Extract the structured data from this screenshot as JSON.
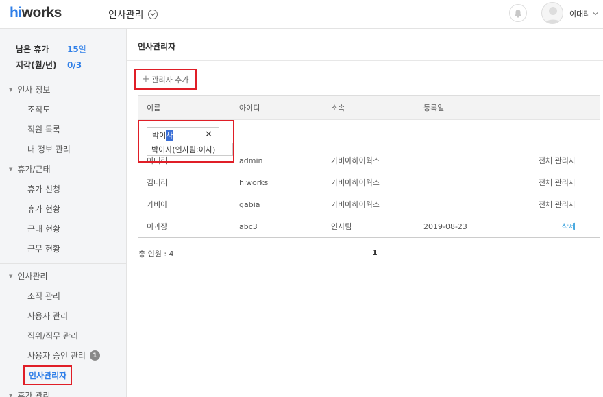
{
  "header": {
    "logo_hi": "hi",
    "logo_rest": "works",
    "app_title": "인사관리",
    "user_name": "이대리"
  },
  "sidebar": {
    "summary": [
      {
        "label": "남은 휴가",
        "value": "15",
        "unit": "일"
      },
      {
        "label": "지각(월/년)",
        "value": "0/3",
        "unit": ""
      }
    ],
    "groups": [
      {
        "title": "인사 정보",
        "items": [
          "조직도",
          "직원 목록",
          "내 정보 관리"
        ]
      },
      {
        "title": "휴가/근태",
        "items": [
          "휴가 신청",
          "휴가 현황",
          "근태 현황",
          "근무 현황"
        ]
      },
      {
        "title": "인사관리",
        "items": [
          "조직 관리",
          "사용자 관리",
          "직위/직무 관리",
          "사용자 승인 관리",
          "인사관리자"
        ]
      },
      {
        "title": "휴가 관리",
        "items": []
      }
    ],
    "approval_badge": "1"
  },
  "main": {
    "title": "인사관리자",
    "add_button": "관리자 추가",
    "columns": [
      "이름",
      "아이디",
      "소속",
      "등록일"
    ],
    "filter": {
      "value_plain": "박이",
      "value_selected": "사",
      "suggestion": "박이사(인사팀:이사)"
    },
    "rows": [
      {
        "name": "이대리",
        "id": "admin",
        "dept": "가비아하이웍스",
        "date": "",
        "role": "전체 관리자"
      },
      {
        "name": "김대리",
        "id": "hiworks",
        "dept": "가비아하이웍스",
        "date": "",
        "role": "전체 관리자"
      },
      {
        "name": "가비아",
        "id": "gabia",
        "dept": "가비아하이웍스",
        "date": "",
        "role": "전체 관리자"
      },
      {
        "name": "이과장",
        "id": "abc3",
        "dept": "인사팀",
        "date": "2019-08-23",
        "role": "삭제"
      }
    ],
    "total": "총 인원 : 4",
    "page": "1"
  },
  "colors": {
    "accent": "#2f7fe8",
    "highlight_border": "#e01e27",
    "link": "#2f9ddb"
  }
}
